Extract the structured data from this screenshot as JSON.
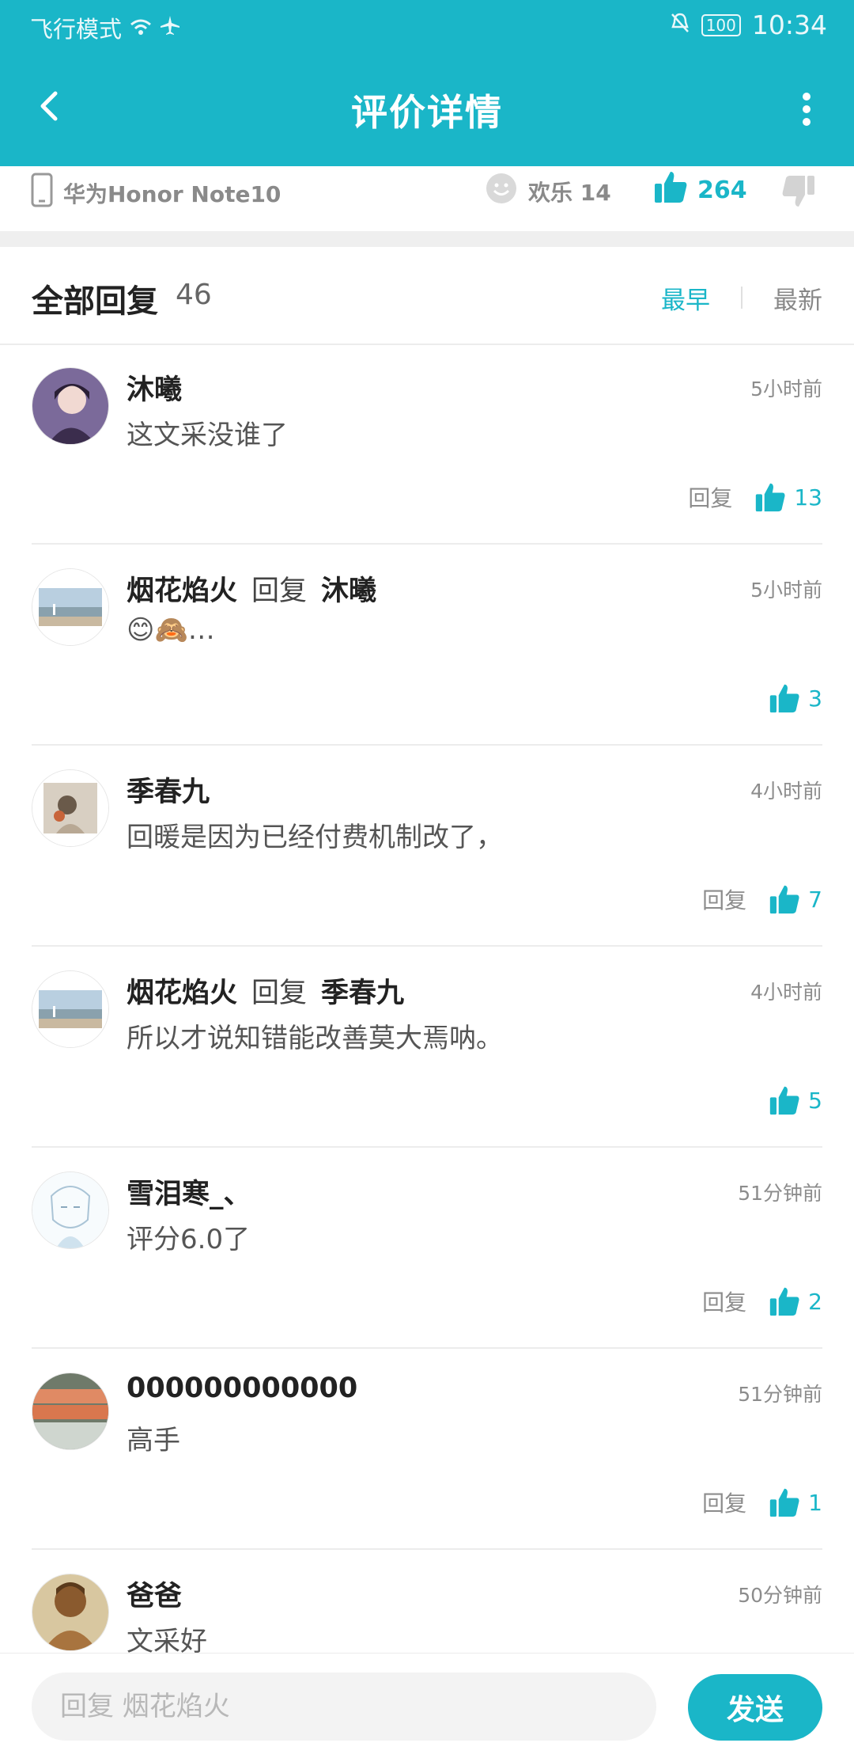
{
  "status": {
    "mode": "飞行模式",
    "battery": "100",
    "time": "10:34"
  },
  "header": {
    "title": "评价详情"
  },
  "device": {
    "name": "华为Honor Note10",
    "mood_label": "欢乐 14",
    "likes": "264"
  },
  "replies_header": {
    "label": "全部回复",
    "count": "46",
    "sort_earliest": "最早",
    "sort_latest": "最新"
  },
  "comments": [
    {
      "name": "沐曦",
      "reply_word": "",
      "reply_to": "",
      "time": "5小时前",
      "text": "这文采没谁了",
      "reply_label": "回复",
      "likes": "13"
    },
    {
      "name": "烟花焰火",
      "reply_word": "回复",
      "reply_to": "沐曦",
      "time": "5小时前",
      "text": "😊🙈…",
      "reply_label": "",
      "likes": "3"
    },
    {
      "name": "季春九",
      "reply_word": "",
      "reply_to": "",
      "time": "4小时前",
      "text": "回暖是因为已经付费机制改了，",
      "reply_label": "回复",
      "likes": "7"
    },
    {
      "name": "烟花焰火",
      "reply_word": "回复",
      "reply_to": "季春九",
      "time": "4小时前",
      "text": "所以才说知错能改善莫大焉呐。",
      "reply_label": "",
      "likes": "5"
    },
    {
      "name": "雪泪寒_、",
      "reply_word": "",
      "reply_to": "",
      "time": "51分钟前",
      "text": "评分6.0了",
      "reply_label": "回复",
      "likes": "2"
    },
    {
      "name": "000000000000",
      "reply_word": "",
      "reply_to": "",
      "time": "51分钟前",
      "text": "高手",
      "reply_label": "回复",
      "likes": "1"
    },
    {
      "name": "爸爸",
      "reply_word": "",
      "reply_to": "",
      "time": "50分钟前",
      "text": "文采好",
      "reply_label": "",
      "likes": ""
    }
  ],
  "bottom": {
    "placeholder": "回复 烟花焰火",
    "send_label": "发送"
  },
  "colors": {
    "accent": "#1ab6c8"
  },
  "icons": [
    "wifi-icon",
    "airplane-icon",
    "mute-icon",
    "back-icon",
    "more-icon",
    "phone-icon",
    "smile-icon",
    "thumb-up-icon",
    "thumb-down-icon"
  ]
}
